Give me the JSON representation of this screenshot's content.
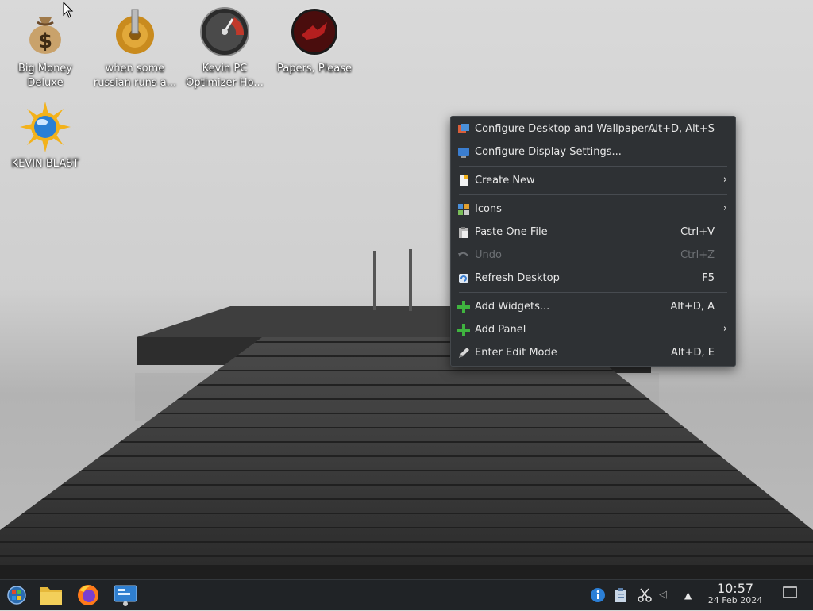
{
  "desktop": {
    "icons": [
      {
        "label_line1": "Big Money",
        "label_line2": "Deluxe",
        "icon": "money-bag-icon"
      },
      {
        "label_line1": "when some",
        "label_line2": "russian runs a...",
        "icon": "gear-icon"
      },
      {
        "label_line1": "Kevin PC",
        "label_line2": "Optimizer Ho...",
        "icon": "speedometer-icon"
      },
      {
        "label_line1": "Papers, Please",
        "label_line2": "",
        "icon": "papers-please-icon"
      },
      {
        "label_line1": "KEVIN BLAST",
        "label_line2": "",
        "icon": "sun-globe-icon"
      }
    ]
  },
  "context_menu": {
    "items": [
      {
        "label": "Configure Desktop and Wallpaper...",
        "shortcut": "Alt+D, Alt+S",
        "icon": "configure-desktop-icon"
      },
      {
        "label": "Configure Display Settings...",
        "shortcut": "",
        "icon": "display-settings-icon"
      },
      {
        "label": "Create New",
        "shortcut": "",
        "icon": "new-document-icon",
        "submenu": true
      },
      {
        "label": "Icons",
        "shortcut": "",
        "icon": "icons-grid-icon",
        "submenu": true
      },
      {
        "label": "Paste One File",
        "shortcut": "Ctrl+V",
        "icon": "paste-icon"
      },
      {
        "label": "Undo",
        "shortcut": "Ctrl+Z",
        "icon": "undo-icon",
        "disabled": true
      },
      {
        "label": "Refresh Desktop",
        "shortcut": "F5",
        "icon": "refresh-icon"
      },
      {
        "label": "Add Widgets...",
        "shortcut": "Alt+D, A",
        "icon": "plus-icon"
      },
      {
        "label": "Add Panel",
        "shortcut": "",
        "icon": "plus-icon",
        "submenu": true
      },
      {
        "label": "Enter Edit Mode",
        "shortcut": "Alt+D, E",
        "icon": "edit-pen-icon"
      }
    ],
    "submenu_arrow": "›"
  },
  "taskbar": {
    "apps": [
      "application-launcher-icon",
      "file-manager-icon",
      "firefox-icon",
      "system-settings-icon"
    ],
    "tray": [
      "info-icon",
      "clipboard-icon",
      "scissors-icon",
      "volume-icon",
      "expand-tray-icon"
    ],
    "expand_glyph": "▲",
    "volume_glyph": "◁",
    "clock": {
      "time": "10:57",
      "date": "24 Feb 2024"
    }
  },
  "colors": {
    "menu_bg": "#2e3134",
    "taskbar_bg": "#202326",
    "plus_green": "#3fb43f"
  }
}
